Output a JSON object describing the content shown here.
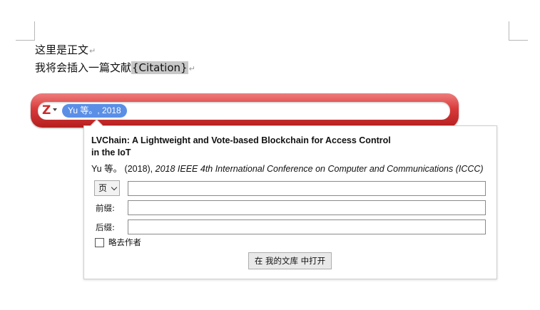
{
  "document": {
    "line1": "这里是正文",
    "line2_prefix": "我将会插入一篇文献",
    "citation_field": "{Citation}",
    "paragraph_mark": "↵"
  },
  "quick_format": {
    "logo_letter": "Z",
    "citation_bubble": "Yu 等。, 2018",
    "colors": {
      "bar_top": "#ef7d7d",
      "bar_bottom": "#b51f1f",
      "bubble": "#5b8fe6"
    }
  },
  "reference_panel": {
    "title": "LVChain: A Lightweight and Vote-based Blockchain for Access Control in the IoT",
    "authors_year": "Yu 等。 (2018), ",
    "venue": "2018 IEEE 4th International Conference on Computer and Communications (ICCC)",
    "locator_selected": "页",
    "prefix_label": "前缀:",
    "suffix_label": "后缀:",
    "omit_author_label": "略去作者",
    "omit_author_checked": false,
    "open_button_label": "在 我的文库 中打开"
  }
}
